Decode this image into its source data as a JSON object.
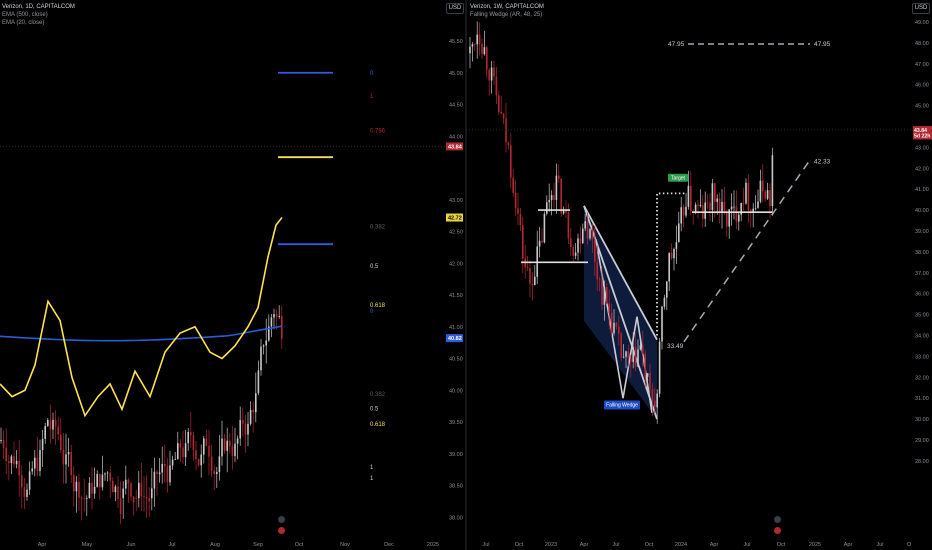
{
  "colors": {
    "background": "#000000",
    "bull": "#c8c8c8",
    "bear": "#b22833",
    "ema_long": "#2a5bd8",
    "ema_short": "#ffe34d",
    "fib_blue": "#2f5de0",
    "fib_yellow": "#f5e15c",
    "axis_text": "#8c8f98",
    "price_tag_red": "#b22833",
    "price_tag_blue": "#2f5de0",
    "price_tag_yellow": "#e8d63c",
    "wedge_fill": "#0e1b3a",
    "target_green": "#2e9a4f",
    "wedge_label_bg": "#1f4bc6",
    "dashed": "#a8aab0"
  },
  "left": {
    "legend": {
      "title": "Verizon, 1D, CAPITALCOM",
      "ema1": "EMA (500, close)",
      "ema2": "EMA (20, close)"
    },
    "currency": "USD",
    "price_labels": [
      {
        "text": "45.50",
        "price": 45.5
      },
      {
        "text": "45.00",
        "price": 45.0
      },
      {
        "text": "44.50",
        "price": 44.5
      },
      {
        "text": "44.00",
        "price": 44.0
      },
      {
        "text": "43.00",
        "price": 43.0
      },
      {
        "text": "42.50",
        "price": 42.5
      },
      {
        "text": "42.00",
        "price": 42.0
      },
      {
        "text": "41.50",
        "price": 41.5
      },
      {
        "text": "41.00",
        "price": 41.0
      },
      {
        "text": "40.50",
        "price": 40.5
      },
      {
        "text": "40.00",
        "price": 40.0
      },
      {
        "text": "39.50",
        "price": 39.5
      },
      {
        "text": "39.00",
        "price": 39.0
      },
      {
        "text": "38.50",
        "price": 38.5
      },
      {
        "text": "38.00",
        "price": 38.0
      }
    ],
    "tags": [
      {
        "text": "43.84",
        "price": 43.84,
        "color": "#b22833",
        "text_color": "#ffffff"
      },
      {
        "text": "42.72",
        "price": 42.72,
        "color": "#e8d63c",
        "text_color": "#000000"
      },
      {
        "text": "40.82",
        "price": 40.82,
        "color": "#2f5de0",
        "text_color": "#ffffff"
      }
    ],
    "time_labels": [
      "Apr",
      "May",
      "Jun",
      "Jul",
      "Aug",
      "Sep",
      "Oct",
      "Nov",
      "Dec",
      "2025"
    ],
    "fib_labels": [
      {
        "text": "0",
        "color": "#2f5de0",
        "price": 45.0
      },
      {
        "text": "1",
        "color": "#b22833",
        "price": 44.63
      },
      {
        "text": "0.786",
        "color": "#b22833",
        "price": 44.09
      },
      {
        "text": "0.382",
        "color": "#5a5d66",
        "price": 42.58
      },
      {
        "text": "0.5",
        "color": "#d0d0d0",
        "price": 41.96
      },
      {
        "text": "0.618",
        "color": "#f5e15c",
        "price": 41.34
      },
      {
        "text": "0",
        "color": "#2f5de0",
        "price": 41.25
      },
      {
        "text": "0.382",
        "color": "#5a5d66",
        "price": 39.94
      },
      {
        "text": "0.5",
        "color": "#d0d0d0",
        "price": 39.71
      },
      {
        "text": "0.618",
        "color": "#f5e15c",
        "price": 39.47
      },
      {
        "text": "1",
        "color": "#d0d0d0",
        "price": 38.79
      },
      {
        "text": "1",
        "color": "#d0d0d0",
        "price": 38.62
      }
    ],
    "fib_lines": [
      {
        "price": 45.0,
        "color": "#2f5de0"
      },
      {
        "price": 43.67,
        "color": "#f5e15c"
      },
      {
        "price": 42.3,
        "color": "#2f5de0"
      }
    ]
  },
  "right": {
    "legend": {
      "title": "Verizon, 1W, CAPITALCOM",
      "indicator": "Falling Wedge (AR, 48, 25)"
    },
    "currency": "USD",
    "price_labels": [
      {
        "text": "49.00",
        "price": 49.0
      },
      {
        "text": "48.00",
        "price": 48.0
      },
      {
        "text": "47.00",
        "price": 47.0
      },
      {
        "text": "46.00",
        "price": 46.0
      },
      {
        "text": "45.00",
        "price": 45.0
      },
      {
        "text": "43.00",
        "price": 43.0
      },
      {
        "text": "42.00",
        "price": 42.0
      },
      {
        "text": "41.00",
        "price": 41.0
      },
      {
        "text": "40.00",
        "price": 40.0
      },
      {
        "text": "39.00",
        "price": 39.0
      },
      {
        "text": "38.00",
        "price": 38.0
      },
      {
        "text": "37.00",
        "price": 37.0
      },
      {
        "text": "36.00",
        "price": 36.0
      },
      {
        "text": "35.00",
        "price": 35.0
      },
      {
        "text": "34.00",
        "price": 34.0
      },
      {
        "text": "33.00",
        "price": 33.0
      },
      {
        "text": "32.00",
        "price": 32.0
      },
      {
        "text": "31.00",
        "price": 31.0
      },
      {
        "text": "30.00",
        "price": 30.0
      },
      {
        "text": "29.00",
        "price": 29.0
      },
      {
        "text": "28.00",
        "price": 28.0
      }
    ],
    "tags": [
      {
        "text": "43.84",
        "price": 43.84,
        "color": "#b22833",
        "text_color": "#ffffff"
      },
      {
        "text": "5d 22h",
        "price": 43.56,
        "color": "#b22833",
        "text_color": "#ffffff"
      }
    ],
    "time_labels": [
      "Jul",
      "Oct",
      "2023",
      "Apr",
      "Jul",
      "Oct",
      "2024",
      "Apr",
      "Jul",
      "Oct",
      "2025",
      "Apr",
      "Jul",
      "O"
    ],
    "annotations": {
      "target_level": "47.95",
      "target_level_right": "47.95",
      "upper_trend": "42.33",
      "low_level": "33.49",
      "target_label": "Target",
      "wedge_label": "Falling Wedge"
    }
  }
}
